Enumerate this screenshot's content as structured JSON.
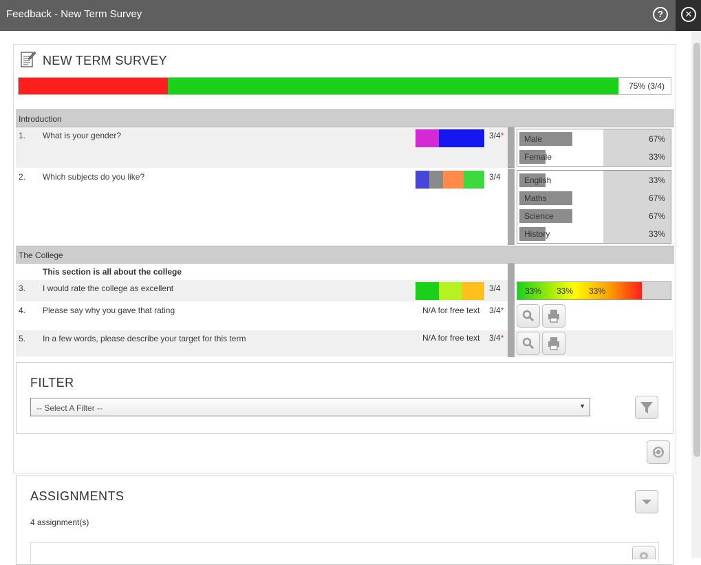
{
  "window": {
    "title": "Feedback - New Term Survey"
  },
  "survey": {
    "title": "NEW TERM SURVEY",
    "progress": {
      "percent": 75,
      "label": "75%  (3/4)"
    }
  },
  "sections": {
    "introduction": "Introduction",
    "college": "The College",
    "college_description": "This section is all about the college"
  },
  "questions": [
    {
      "num": "1.",
      "text": "What is your gender?",
      "count": "3/4",
      "required": "*",
      "answers": [
        {
          "label": "Male",
          "pct": "67%",
          "value": 0.67
        },
        {
          "label": "Female",
          "pct": "33%",
          "value": 0.33
        }
      ],
      "mini_colors": [
        "#d629d6",
        "#1616f0"
      ],
      "mini_weights": [
        0.34,
        0.66
      ]
    },
    {
      "num": "2.",
      "text": "Which subjects do you like?",
      "count": "3/4",
      "required": "",
      "answers": [
        {
          "label": "English",
          "pct": "33%",
          "value": 0.33
        },
        {
          "label": "Maths",
          "pct": "67%",
          "value": 0.67
        },
        {
          "label": "Science",
          "pct": "67%",
          "value": 0.67
        },
        {
          "label": "History",
          "pct": "33%",
          "value": 0.33
        }
      ],
      "mini_colors": [
        "#4646d8",
        "#8a8a8a",
        "#ff8a4a",
        "#3ed93e"
      ],
      "mini_weights": [
        0.2,
        0.2,
        0.3,
        0.3
      ]
    },
    {
      "num": "3.",
      "text": "I would rate the college as excellent",
      "count": "3/4",
      "required": "",
      "rating": [
        "33%",
        "33%",
        "33%"
      ],
      "mini_colors": [
        "#19d119",
        "#b5f21f",
        "#ffbf1e"
      ],
      "mini_weights": [
        0.34,
        0.33,
        0.33
      ]
    },
    {
      "num": "4.",
      "text": "Please say why you gave that rating",
      "count": "3/4",
      "required": "*",
      "na": "N/A for free text"
    },
    {
      "num": "5.",
      "text": "In a few words, please describe your target for this term",
      "count": "3/4",
      "required": "*",
      "na": "N/A for free text"
    }
  ],
  "filter": {
    "title": "FILTER",
    "select_value": "-- Select A Filter --"
  },
  "assignments": {
    "title": "ASSIGNMENTS",
    "count_text": "4 assignment(s)"
  },
  "icons": {
    "help": "help-circle-icon",
    "close": "close-circle-icon",
    "survey": "survey-notepad-icon",
    "search": "magnifier-icon",
    "print": "printer-icon",
    "filter": "funnel-icon",
    "refresh": "refresh-icon",
    "expand": "chevron-down-icon",
    "settings": "gear-icon"
  },
  "colors": {
    "titlebar": "#5f5f5f",
    "progress_red": "#ff1e1e",
    "progress_green": "#19d119",
    "section_bg": "#cdcdcd"
  }
}
